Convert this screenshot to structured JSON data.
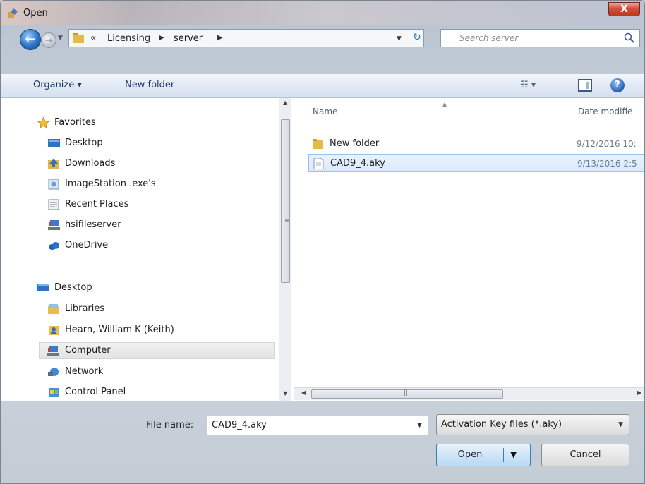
{
  "window": {
    "title": "Open",
    "close_glyph": "X"
  },
  "address": {
    "overflow": "«",
    "crumbs": [
      "Licensing",
      "server"
    ],
    "search_placeholder": "Search server"
  },
  "toolbar": {
    "organize": "Organize ▾",
    "new_folder": "New folder",
    "views": "☷ ▾",
    "help": "?"
  },
  "nav": {
    "favorites": [
      {
        "label": "Favorites",
        "icon": "star-icon"
      },
      {
        "label": "Desktop",
        "icon": "desktop-icon"
      },
      {
        "label": "Downloads",
        "icon": "downloads-icon"
      },
      {
        "label": "ImageStation .exe's",
        "icon": "library-icon"
      },
      {
        "label": "Recent Places",
        "icon": "recent-places-icon"
      },
      {
        "label": "hsifileserver",
        "icon": "network-drive-icon"
      },
      {
        "label": "OneDrive",
        "icon": "cloud-icon"
      }
    ],
    "tree": [
      {
        "label": "Desktop",
        "icon": "desktop-icon"
      },
      {
        "label": "Libraries",
        "icon": "libraries-icon"
      },
      {
        "label": "Hearn, William K (Keith)",
        "icon": "user-folder-icon"
      },
      {
        "label": "Computer",
        "icon": "computer-icon",
        "selected": true
      },
      {
        "label": "Network",
        "icon": "network-icon"
      },
      {
        "label": "Control Panel",
        "icon": "control-panel-icon"
      }
    ]
  },
  "files": {
    "columns": {
      "name": "Name",
      "date": "Date modifie"
    },
    "rows": [
      {
        "name": "New folder",
        "date": "9/12/2016 10:",
        "icon": "folder-icon"
      },
      {
        "name": "CAD9_4.aky",
        "date": "9/13/2016 2:5",
        "icon": "file-icon",
        "selected": true
      }
    ]
  },
  "bottom": {
    "file_name_label": "File name:",
    "file_name_value": "CAD9_4.aky",
    "filter_value": "Activation Key files (*.aky)",
    "open_label": "Open",
    "cancel_label": "Cancel"
  },
  "colors": {
    "selection": "#d9e9fc",
    "accent": "#3c7fb1"
  }
}
